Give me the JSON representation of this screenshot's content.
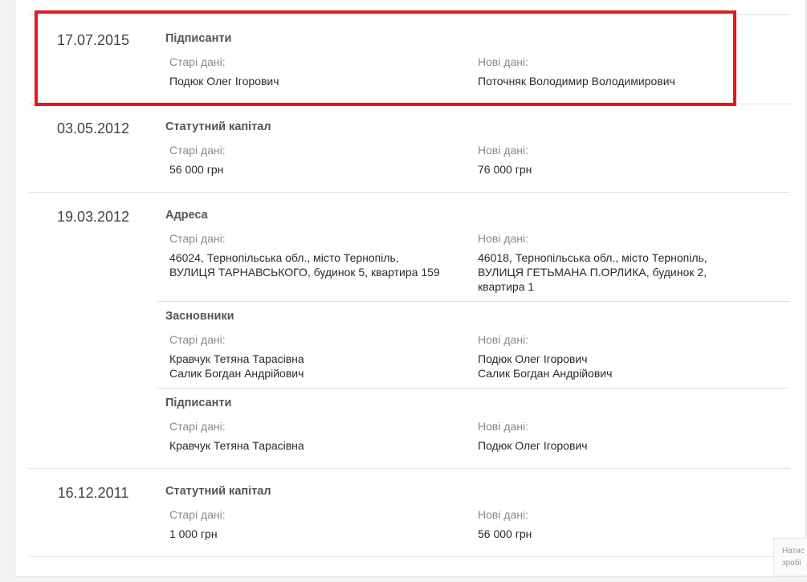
{
  "history": {
    "entries": [
      {
        "date": "17.07.2015",
        "changes": [
          {
            "field": "Підписанти",
            "old_label": "Старі дані:",
            "new_label": "Нові дані:",
            "old": [
              "Подюк Олег Ігорович"
            ],
            "new": [
              "Поточняк Володимир Володимирович"
            ]
          }
        ]
      },
      {
        "date": "03.05.2012",
        "changes": [
          {
            "field": "Статутний капітал",
            "old_label": "Старі дані:",
            "new_label": "Нові дані:",
            "old": [
              "56 000 грн"
            ],
            "new": [
              "76 000 грн"
            ]
          }
        ]
      },
      {
        "date": "19.03.2012",
        "changes": [
          {
            "field": "Адреса",
            "old_label": "Старі дані:",
            "new_label": "Нові дані:",
            "old": [
              "46024, Тернопільська обл., місто Тернопіль,",
              "ВУЛИЦЯ ТАРНАВСЬКОГО, будинок 5, квартира 159"
            ],
            "new": [
              "46018, Тернопільська обл., місто Тернопіль,",
              "ВУЛИЦЯ ГЕТЬМАНА П.ОРЛИКА, будинок 2,",
              "квартира 1"
            ]
          },
          {
            "field": "Засновники",
            "old_label": "Старі дані:",
            "new_label": "Нові дані:",
            "old": [
              "Кравчук Тетяна Тарасівна",
              "Салик Богдан Андрійович"
            ],
            "new": [
              "Подюк Олег Ігорович",
              "Салик Богдан Андрійович"
            ]
          },
          {
            "field": "Підписанти",
            "old_label": "Старі дані:",
            "new_label": "Нові дані:",
            "old": [
              "Кравчук Тетяна Тарасівна"
            ],
            "new": [
              "Подюк Олег Ігорович"
            ]
          }
        ]
      },
      {
        "date": "16.12.2011",
        "changes": [
          {
            "field": "Статутний капітал",
            "old_label": "Старі дані:",
            "new_label": "Нові дані:",
            "old": [
              "1 000 грн"
            ],
            "new": [
              "56 000 грн"
            ]
          }
        ]
      }
    ]
  },
  "hint": {
    "line1": "Натис",
    "line2": "зробі"
  },
  "colors": {
    "highlight": "#e21a1a",
    "divider": "#e0e0e0"
  }
}
